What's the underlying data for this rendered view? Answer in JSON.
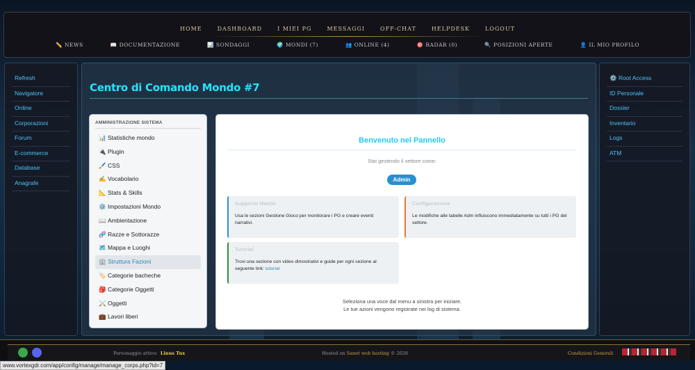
{
  "top_nav": [
    "HOME",
    "DASHBOARD",
    "I MIEI PG",
    "MESSAGGI",
    "OFF-CHAT",
    "HELPDESK",
    "LOGOUT"
  ],
  "sub_nav": [
    {
      "icon": "✏️",
      "label": "NEWS"
    },
    {
      "icon": "📖",
      "label": "DOCUMENTAZIONE"
    },
    {
      "icon": "📊",
      "label": "SONDAGGI"
    },
    {
      "icon": "🌍",
      "label": "MONDI (7)"
    },
    {
      "icon": "👥",
      "label": "ONLINE (4)"
    },
    {
      "icon": "🎯",
      "label": "RADAR (0)"
    },
    {
      "icon": "🔍",
      "label": "POSIZIONI APERTE"
    },
    {
      "icon": "👤",
      "label": "IL MIO PROFILO"
    }
  ],
  "left_sidebar": [
    "Refresh",
    "Navigatore",
    "Online",
    "Corporazioni",
    "Forum",
    "E-commerce",
    "Database",
    "Anagrafe"
  ],
  "right_sidebar": [
    "⚙️ Root Access",
    "ID Personale",
    "Dossier",
    "Inventario",
    "Logs",
    "ATM"
  ],
  "main": {
    "title": "Centro di Comando Mondo #7",
    "menu_heading": "AMMINISTRAZIONE SISTEMA",
    "menu": [
      {
        "icon": "📊",
        "label": "Statistiche mondo"
      },
      {
        "icon": "🔌",
        "label": "Plugin"
      },
      {
        "icon": "🖌️",
        "label": "CSS"
      },
      {
        "icon": "✍️",
        "label": "Vocabolario"
      },
      {
        "icon": "📐",
        "label": "Stats & Skills"
      },
      {
        "icon": "⚙️",
        "label": "Impostazioni Mondo"
      },
      {
        "icon": "📖",
        "label": "Ambientazione"
      },
      {
        "icon": "🧬",
        "label": "Razze e Sottorazze"
      },
      {
        "icon": "🗺️",
        "label": "Mappa e Luoghi"
      },
      {
        "icon": "🏢",
        "label": "Struttura Fazioni"
      },
      {
        "icon": "🏷️",
        "label": "Categorie bacheche"
      },
      {
        "icon": "🎒",
        "label": "Categorie Oggetti"
      },
      {
        "icon": "⚔️",
        "label": "Oggetti"
      },
      {
        "icon": "💼",
        "label": "Lavori liberi"
      }
    ],
    "active_menu_index": 9,
    "welcome": {
      "title": "Benvenuto nel Pannello",
      "subtitle": "Stai gestendo il settore come:",
      "role": "Admin",
      "cards": [
        {
          "title": "Supporto Master",
          "body": "Usa le sezioni Gestione Gioco per monitorare i PG e creare eventi narrativi.",
          "accent": "#2a8fd0"
        },
        {
          "title": "Configurazione",
          "body": "Le modifiche alle tabelle Adm influiscono immediatamente su tutti i PG del settore.",
          "accent": "#e07a2e"
        },
        {
          "title": "Tutorial",
          "body": "Trovi una sezione con video dimostrativi e guide per ogni sezione al seguente link:",
          "link": "tutorial",
          "accent": "#2f8f3a"
        }
      ],
      "footer_line1": "Seleziona una voce dal menu a sinistra per iniziare.",
      "footer_line2": "Le tue azioni vengono registrate nei log di sistema."
    }
  },
  "footer": {
    "character_label": "Personaggio attivo:",
    "character_name": "Linus Tux",
    "hosted_prefix": "Hosted on ",
    "hosted_link": "Sanet web hosting",
    "hosted_suffix": " © 2026",
    "conditions": "Condizioni Generali"
  },
  "status_url": "www.vortexgdr.com/app/config/manage/manage_corps.php?id=7",
  "colors": {
    "accent_cyan": "#25e3ff",
    "link_blue": "#4fc3f7",
    "gold": "#d8c9a0"
  }
}
